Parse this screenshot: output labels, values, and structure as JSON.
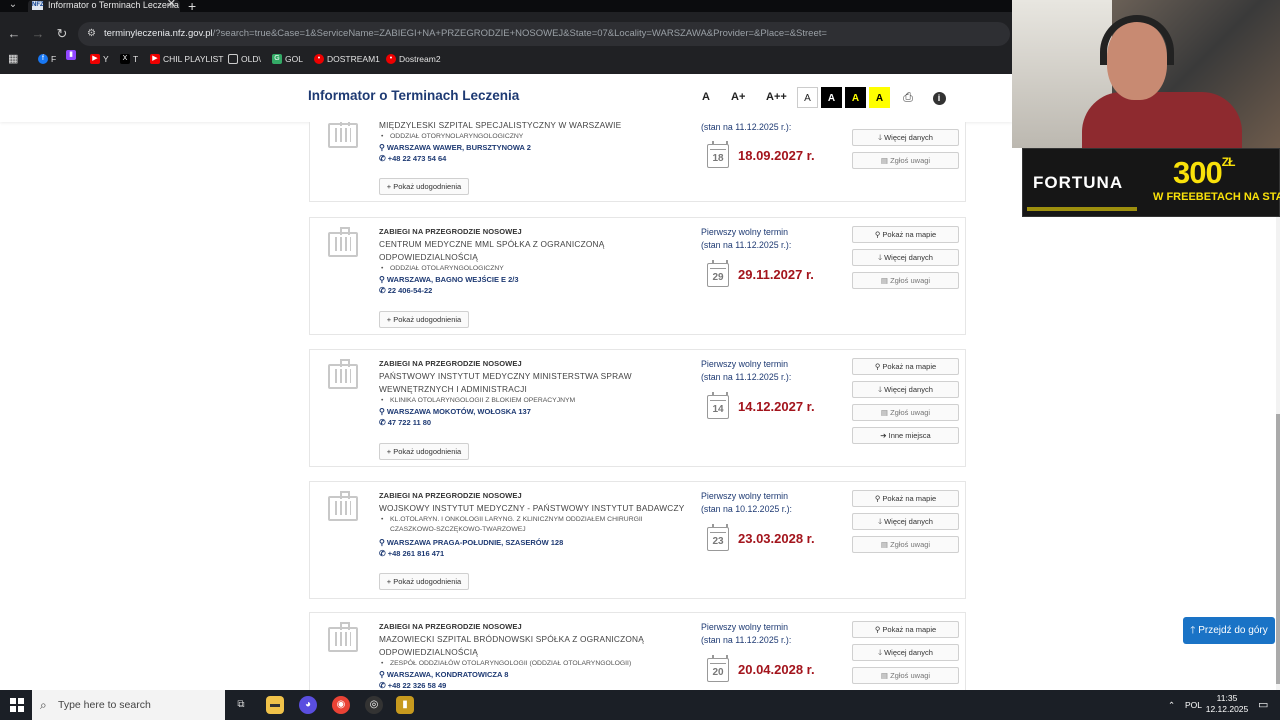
{
  "browser": {
    "tab_title": "Informator o Terminach Leczenia",
    "tab_favicon": "NFZ",
    "url_domain": "terminyleczenia.nfz.gov.pl",
    "url_rest": "/?search=true&Case=1&ServiceName=ZABIEGI+NA+PRZEGRODZIE+NOSOWEJ&State=07&Locality=WARSZAWA&Provider=&Place=&Street=",
    "bookmarks": [
      "F",
      "Y",
      "T",
      "CHIL PLAYLIST",
      "OLD\\",
      "GOL",
      "DOSTREAM1",
      "Dostream2"
    ]
  },
  "header": {
    "title": "Informator o Terminach Leczenia",
    "font_small": "A",
    "font_medium": "A+",
    "font_large": "A++",
    "contrast": [
      "A",
      "A",
      "A",
      "A"
    ]
  },
  "labels": {
    "service": "ZABIEGI NA PRZEGRODZIE NOSOWEJ",
    "first_term": "Pierwszy wolny termin",
    "show_updates": "Pokaż udogodnienia",
    "show_map": "Pokaż na mapie",
    "more_data": "Więcej danych",
    "report": "Zgłoś uwagi",
    "other_places": "Inne miejsca",
    "to_top": "Przejdź do góry"
  },
  "results": [
    {
      "name": "MIĘDZYLESKI SZPITAL SPECJALISTYCZNY W WARSZAWIE",
      "dept": "ODDZIAŁ OTORYNOLARYNGOLOGICZNY",
      "address": "WARSZAWA WAWER, BURSZTYNOWA 2",
      "phone": "+48 22 473 54 64",
      "status": "(stan na 11.12.2025 r.):",
      "cal_day": "18",
      "date": "18.09.2027 r."
    },
    {
      "name": "CENTRUM MEDYCZNE MML SPÓŁKA Z OGRANICZONĄ ODPOWIEDZIALNOŚCIĄ",
      "dept": "ODDZIAŁ OTOLARYNGOLOGICZNY",
      "address": "WARSZAWA, BAGNO WEJŚCIE E 2/3",
      "phone": "22 406-54-22",
      "status": "(stan na 11.12.2025 r.):",
      "cal_day": "29",
      "date": "29.11.2027 r."
    },
    {
      "name": "PAŃSTWOWY INSTYTUT MEDYCZNY MINISTERSTWA SPRAW WEWNĘTRZNYCH I ADMINISTRACJI",
      "dept": "KLINIKA OTOLARYNGOLOGII Z BLOKIEM OPERACYJNYM",
      "address": "WARSZAWA MOKOTÓW, WOŁOSKA 137",
      "phone": "47 722 11 80",
      "status": "(stan na 11.12.2025 r.):",
      "cal_day": "14",
      "date": "14.12.2027 r."
    },
    {
      "name": "WOJSKOWY INSTYTUT MEDYCZNY - PAŃSTWOWY INSTYTUT BADAWCZY",
      "dept": "KL.OTOLARYN. I ONKOLOGII LARYNG. Z KLINICZNYM ODDZIAŁEM CHIRURGII CZASZKOWO-SZCZĘKOWO-TWARZOWEJ",
      "address": "WARSZAWA PRAGA-POŁUDNIE, SZASERÓW 128",
      "phone": "+48 261 816 471",
      "status": "(stan na 10.12.2025 r.):",
      "cal_day": "23",
      "date": "23.03.2028 r."
    },
    {
      "name": "MAZOWIECKI SZPITAL BRÓDNOWSKI SPÓŁKA Z OGRANICZONĄ ODPOWIEDZIALNOŚCIĄ",
      "dept": "ZESPÓŁ ODDZIAŁÓW OTOLARYNGOLOGII (ODDZIAŁ OTOLARYNGOLOGII)",
      "address": "WARSZAWA, KONDRATOWICZA 8",
      "phone": "+48 22 326 58 49",
      "status": "(stan na 11.12.2025 r.):",
      "cal_day": "20",
      "date": "20.04.2028 r."
    }
  ],
  "ad": {
    "brand": "FORTUNA",
    "amount": "300",
    "currency": "ZŁ",
    "subtitle": "W FREEBETACH NA STA"
  },
  "taskbar": {
    "search_placeholder": "Type here to search",
    "language": "POL",
    "time": "11:35",
    "date": "12.12.2025"
  }
}
